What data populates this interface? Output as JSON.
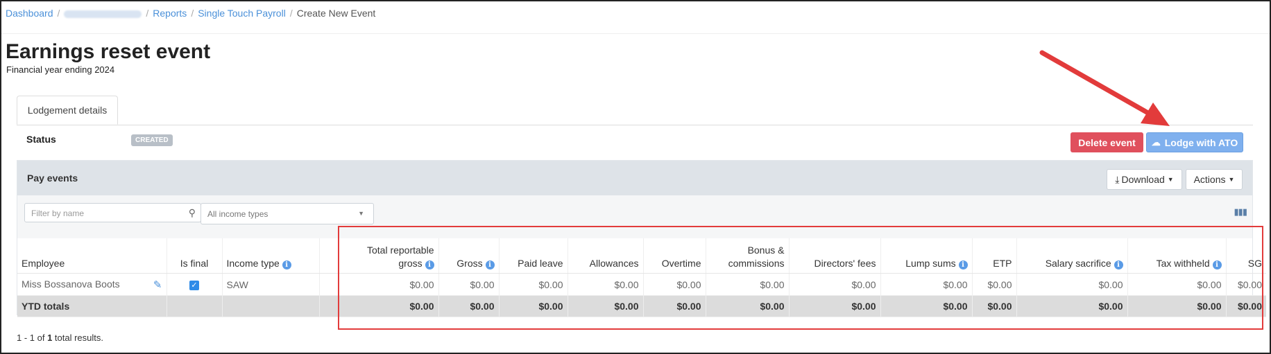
{
  "breadcrumb": {
    "items": [
      "Dashboard",
      "Reports",
      "Single Touch Payroll"
    ],
    "current": "Create New Event"
  },
  "page": {
    "title": "Earnings reset event",
    "subtitle": "Financial year ending 2024"
  },
  "tabs": [
    "Lodgement details"
  ],
  "status": {
    "label": "Status",
    "badge": "CREATED"
  },
  "buttons": {
    "delete": "Delete event",
    "lodge": "Lodge with ATO"
  },
  "pay_events": {
    "title": "Pay events",
    "download": "Download",
    "actions": "Actions",
    "filter_placeholder": "Filter by name",
    "income_select": "All income types"
  },
  "table": {
    "headers": [
      "Employee",
      "Is final",
      "Income type",
      "",
      "Total reportable gross",
      "Gross",
      "Paid leave",
      "Allowances",
      "Overtime",
      "Bonus & commissions",
      "Directors' fees",
      "Lump sums",
      "ETP",
      "Salary sacrifice",
      "Tax withheld",
      "SG"
    ],
    "row": {
      "employee": "Miss Bossanova Boots",
      "income_type": "SAW",
      "values": [
        "$0.00",
        "$0.00",
        "$0.00",
        "$0.00",
        "$0.00",
        "$0.00",
        "$0.00",
        "$0.00",
        "$0.00",
        "$0.00",
        "$0.00",
        "$0.00"
      ]
    },
    "totals": {
      "label": "YTD totals",
      "values": [
        "$0.00",
        "$0.00",
        "$0.00",
        "$0.00",
        "$0.00",
        "$0.00",
        "$0.00",
        "$0.00",
        "$0.00",
        "$0.00",
        "$0.00",
        "$0.00"
      ]
    }
  },
  "results": {
    "prefix": "1 - 1 of ",
    "count": "1",
    "suffix": " total results."
  },
  "colors": {
    "annotation": "#e23b3b",
    "delete": "#e0505d",
    "lodge": "#7fb0ee"
  }
}
